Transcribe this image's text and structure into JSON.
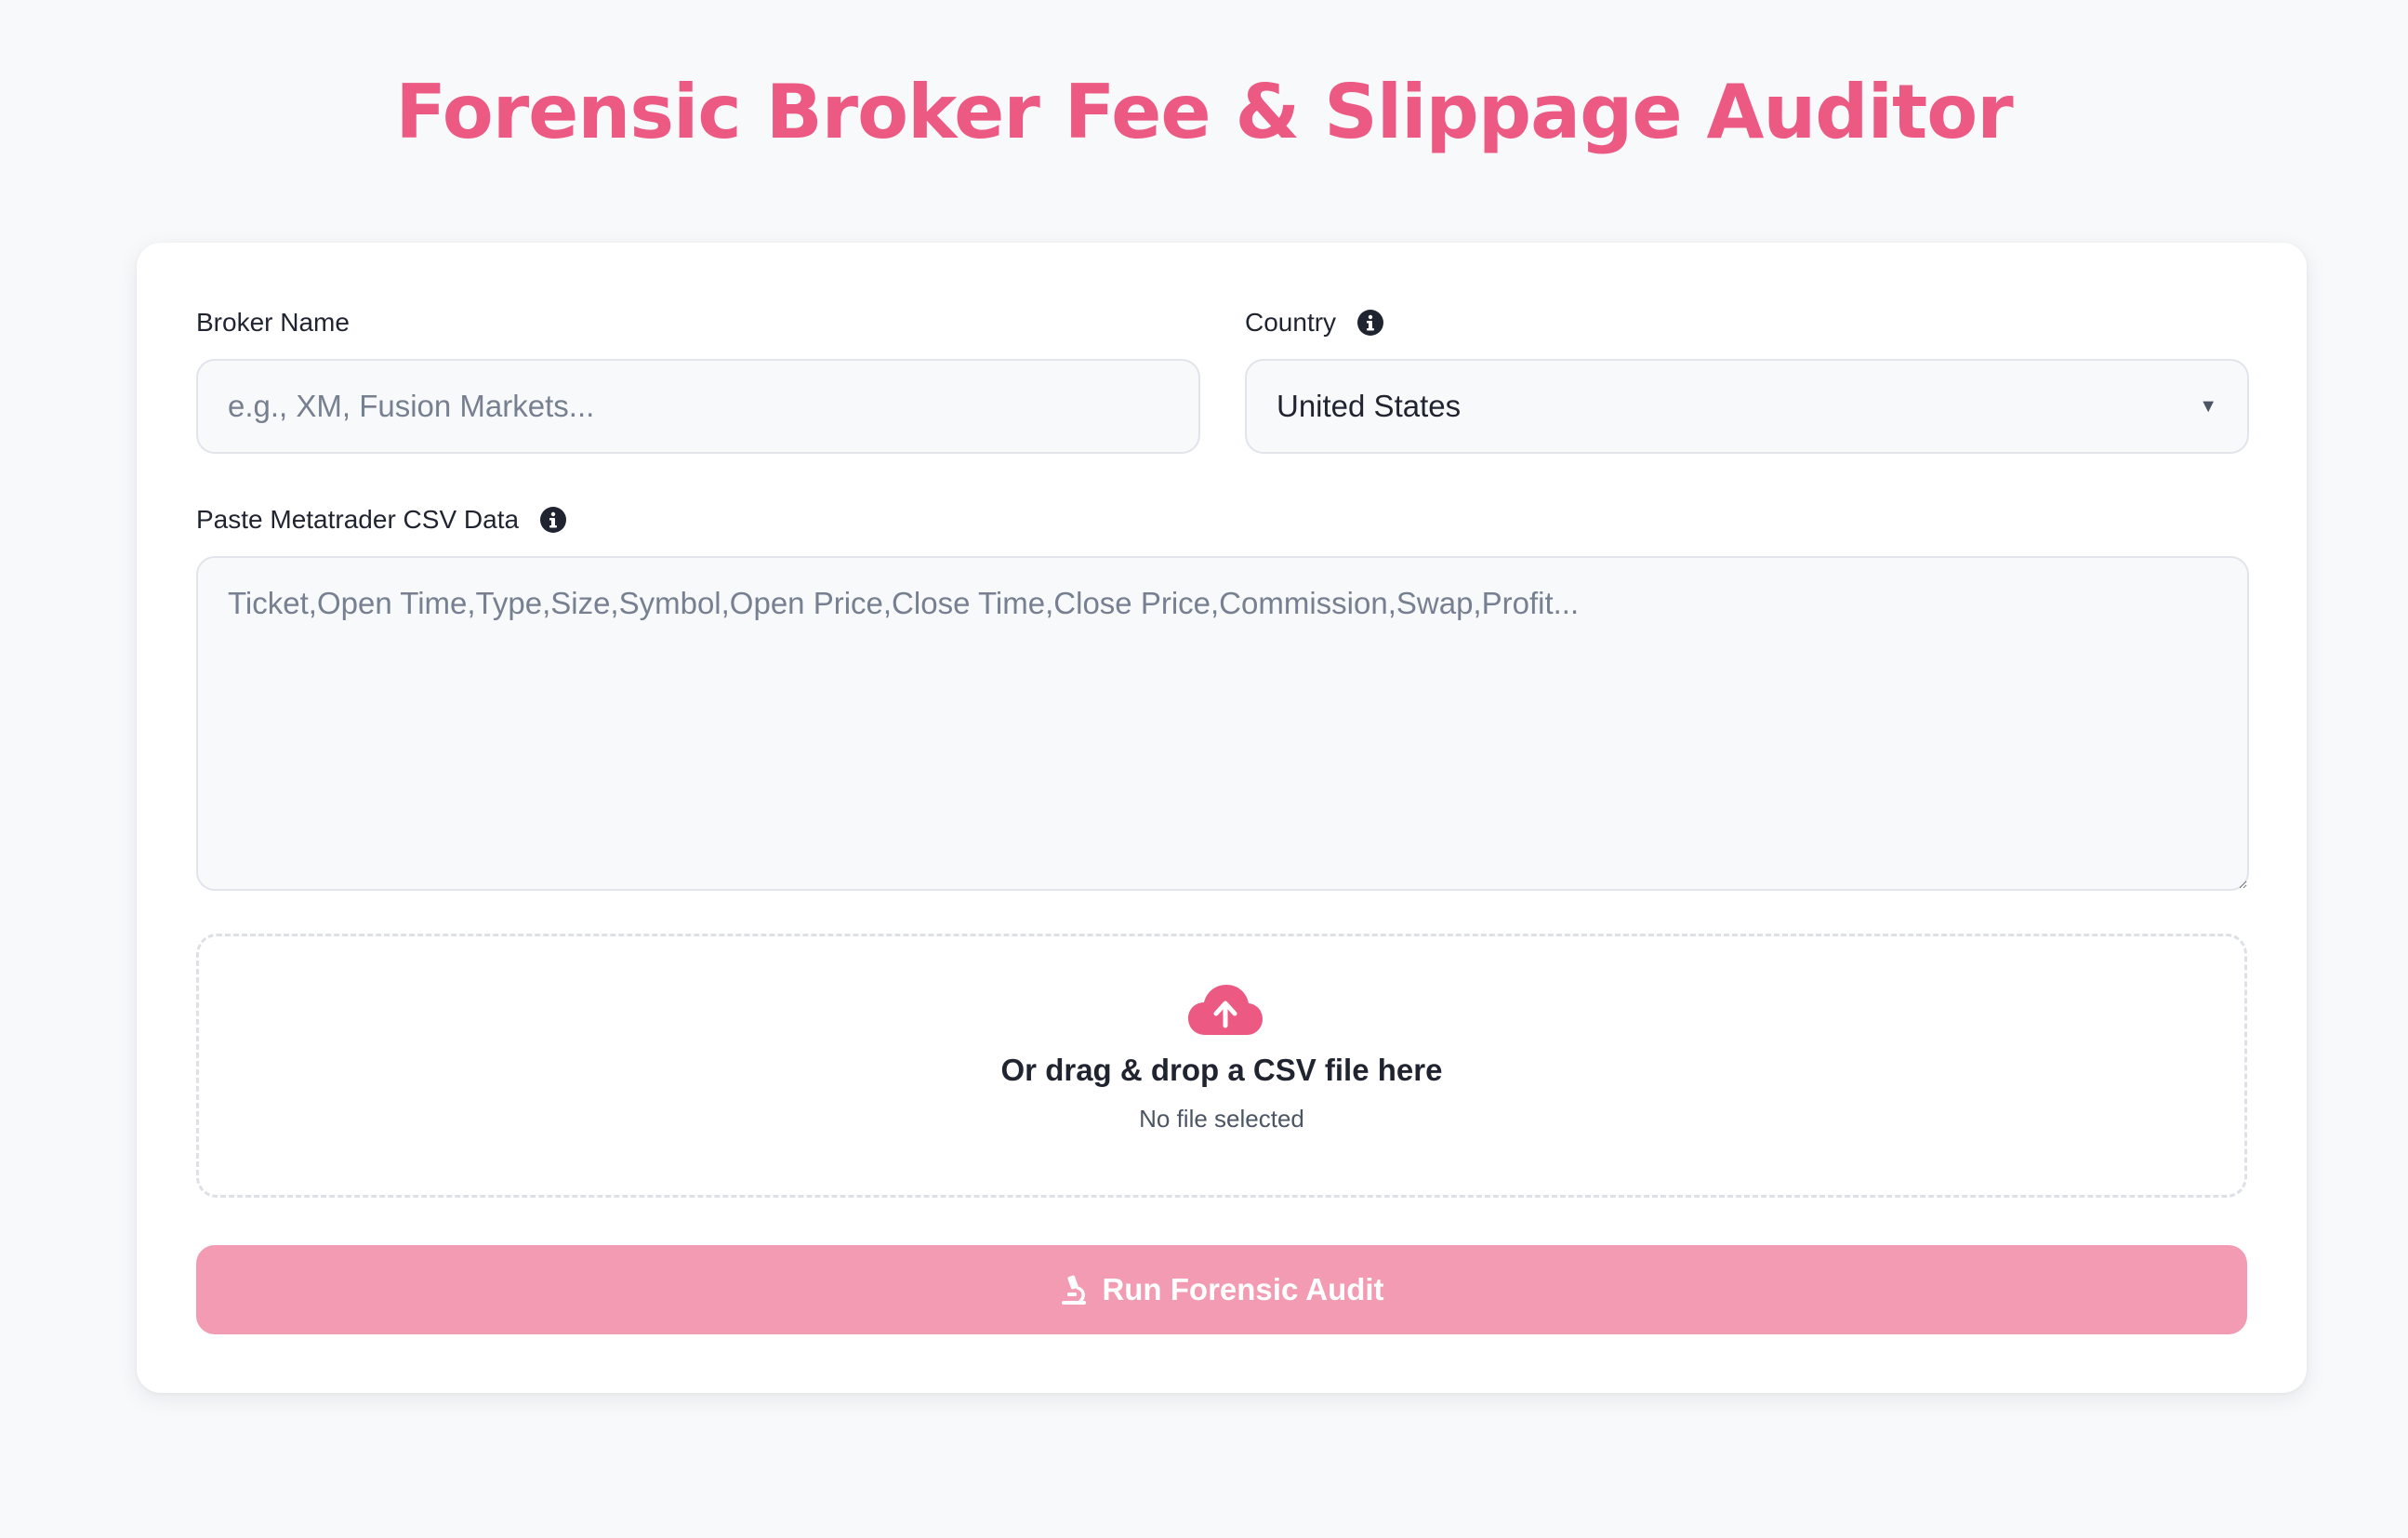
{
  "page": {
    "title": "Forensic Broker Fee & Slippage Auditor"
  },
  "form": {
    "broker_name": {
      "label": "Broker Name",
      "value": "",
      "placeholder": "e.g., XM, Fusion Markets..."
    },
    "country": {
      "label": "Country",
      "selected": "United States",
      "info_icon": "info-icon"
    },
    "csv_data": {
      "label": "Paste Metatrader CSV Data",
      "value": "",
      "placeholder": "Ticket,Open Time,Type,Size,Symbol,Open Price,Close Time,Close Price,Commission,Swap,Profit...",
      "info_icon": "info-icon"
    },
    "dropzone": {
      "icon": "cloud-upload-icon",
      "title": "Or drag & drop a CSV file here",
      "status": "No file selected"
    },
    "submit": {
      "icon": "microscope-icon",
      "label": "Run Forensic Audit"
    }
  },
  "colors": {
    "accent": "#ec5a83",
    "button_disabled": "#f29bb2",
    "background": "#f8f9fb",
    "card": "#ffffff"
  }
}
